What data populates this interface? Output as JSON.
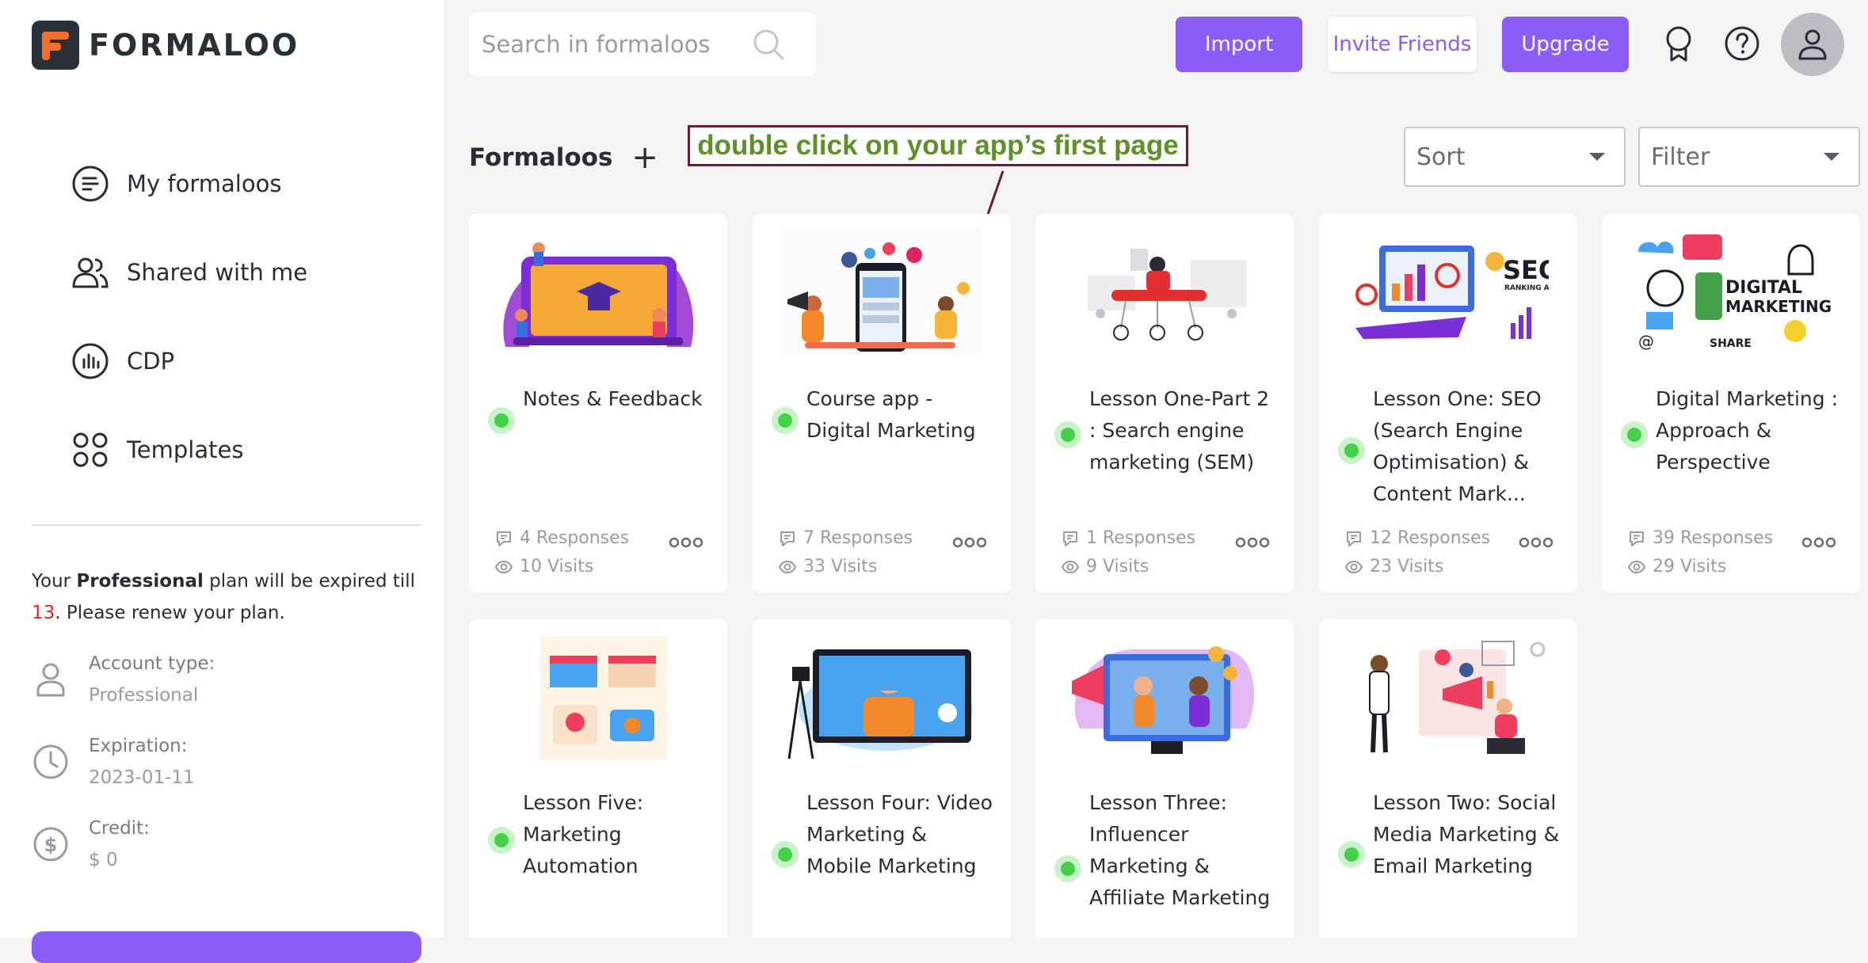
{
  "brand": {
    "name": "FORMALOO"
  },
  "sidebar": {
    "items": [
      {
        "label": "My formaloos",
        "icon": "list-icon"
      },
      {
        "label": "Shared with me",
        "icon": "users-icon"
      },
      {
        "label": "CDP",
        "icon": "chart-icon"
      },
      {
        "label": "Templates",
        "icon": "grid-icon"
      }
    ],
    "plan": {
      "prefix": "Your ",
      "plan_name": "Professional",
      "middle": " plan will be expired till",
      "days": "13",
      "suffix": ". Please renew your plan."
    },
    "account_type_label": "Account type:",
    "account_type_value": "Professional",
    "expiration_label": "Expiration:",
    "expiration_value": "2023-01-11",
    "credit_label": "Credit:",
    "credit_value": "$ 0"
  },
  "topbar": {
    "search_placeholder": "Search in formaloos",
    "import_label": "Import",
    "invite_label": "Invite Friends",
    "upgrade_label": "Upgrade"
  },
  "main": {
    "title": "Formaloos",
    "plus": "+",
    "annotation": "double click on your app’s first page",
    "sort_label": "Sort",
    "filter_label": "Filter"
  },
  "cards": [
    {
      "title": "Notes & Feedback",
      "responses": "4 Responses",
      "visits": "10 Visits"
    },
    {
      "title": "Course app - Digital Marketing",
      "responses": "7 Responses",
      "visits": "33 Visits"
    },
    {
      "title": "Lesson One-Part 2 : Search engine marketing (SEM)",
      "responses": "1 Responses",
      "visits": "9 Visits"
    },
    {
      "title": "Lesson One: SEO (Search Engine Optimisation) & Content Mark...",
      "responses": "12 Responses",
      "visits": "23 Visits"
    },
    {
      "title": "Digital Marketing : Approach & Perspective",
      "responses": "39 Responses",
      "visits": "29 Visits"
    },
    {
      "title": "Lesson Five: Marketing Automation"
    },
    {
      "title": "Lesson Four: Video Marketing & Mobile Marketing"
    },
    {
      "title": "Lesson Three: Influencer Marketing & Affiliate Marketing"
    },
    {
      "title": "Lesson Two: Social Media Marketing & Email Marketing"
    }
  ],
  "thumb_texts": {
    "seo": "SEO",
    "seo_sub": "RANKING ANALYSIS",
    "dm1": "DIGITAL",
    "dm2": "MARKETING",
    "share": "SHARE"
  },
  "colors": {
    "accent": "#8b5cf6",
    "status_green": "#43d14a",
    "annotation_text": "#5f8e2a",
    "annotation_border": "#6b1a3a"
  }
}
